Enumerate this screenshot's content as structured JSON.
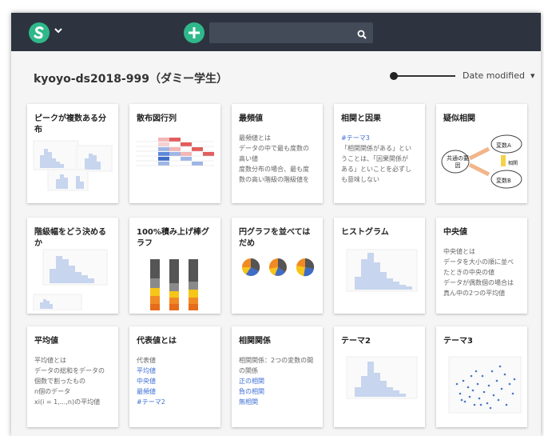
{
  "header": {
    "logo_icon": "jupyter-s-logo",
    "add_icon": "plus-icon",
    "search_placeholder": "",
    "search_icon": "search-icon"
  },
  "owner_title": "kyoyo-ds2018-999（ダミー学生）",
  "sort_label": "Date modified",
  "cards": [
    {
      "title": "ピークが複数ある分布"
    },
    {
      "title": "散布図行列"
    },
    {
      "title": "最頻値",
      "lines": [
        "最頻値とは",
        "データの中で最も度数の",
        "高い値",
        "度数分布の場合、最も度",
        "数の高い階級の階級値を"
      ],
      "link_index": [
        3
      ]
    },
    {
      "title": "相関と因果",
      "lines": [
        "#テーマ3",
        "「相関関係がある」とい",
        "うことは、「因果関係が",
        "ある」といことを必ずし",
        "も意味しない"
      ]
    },
    {
      "title": "疑似相関",
      "diagram": {
        "center": "共通の要因",
        "a": "変数A",
        "b": "変数B",
        "rel": "相関"
      }
    },
    {
      "title": "階級幅をどう決めるか"
    },
    {
      "title": "100%積み上げ棒グラフ"
    },
    {
      "title": "円グラフを並べてはだめ"
    },
    {
      "title": "ヒストグラム"
    },
    {
      "title": "中央値",
      "lines": [
        "中央値とは",
        "データを大小の順に並べ",
        "たときの中央の値",
        "データが偶数個の場合は",
        "真ん中の2つの平均値"
      ]
    },
    {
      "title": "平均値",
      "lines": [
        "平均値とは",
        "データの総和をデータの",
        "個数で割ったもの",
        "n個のデータ",
        "xi(i = 1,...,n)の平均値"
      ]
    },
    {
      "title": "代表値とは",
      "lines": [
        "代表値",
        "平均値",
        "中央値",
        "最頻値",
        "#テーマ2"
      ]
    },
    {
      "title": "相関関係",
      "lines": [
        "相関関係：2つの変数の間",
        "の関係",
        "正の相関",
        "負の相関",
        "無相関"
      ]
    },
    {
      "title": "テーマ2"
    },
    {
      "title": "テーマ3"
    }
  ]
}
